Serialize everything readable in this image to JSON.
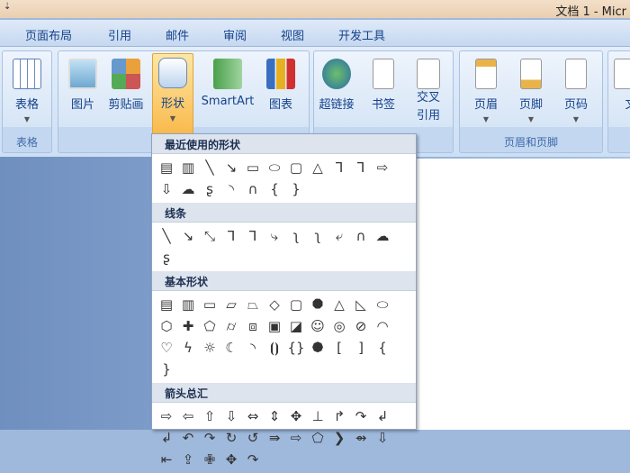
{
  "title_bar": {
    "title": "文档 1 - Micr",
    "qat": "⇣"
  },
  "tabs": [
    "页面布局",
    "引用",
    "邮件",
    "审阅",
    "视图",
    "开发工具"
  ],
  "ribbon": {
    "table_group": {
      "button": "表格",
      "label": "表格"
    },
    "illustrations": [
      "图片",
      "剪贴画",
      "形状",
      "SmartArt",
      "图表"
    ],
    "links": [
      "超链接",
      "书签",
      "交叉\n引用"
    ],
    "header_footer": {
      "buttons": [
        "页眉",
        "页脚",
        "页码"
      ],
      "label": "页眉和页脚"
    },
    "partial": "文"
  },
  "menu": {
    "sections": [
      {
        "title": "最近使用的形状",
        "shapes": [
          "▤",
          "▥",
          "╲",
          "↘",
          "▭",
          "⬭",
          "▢",
          "△",
          "⅂",
          "⅂",
          "⇨",
          "⇩",
          "☁",
          "ʂ",
          "◝",
          "∩",
          "{",
          "}"
        ]
      },
      {
        "title": "线条",
        "shapes": [
          "╲",
          "↘",
          "⤡",
          "⅂",
          "⅂",
          "⤷",
          "ʅ",
          "ʅ",
          "⤶",
          "∩",
          "☁",
          "ʂ"
        ]
      },
      {
        "title": "基本形状",
        "shapes": [
          "▤",
          "▥",
          "▭",
          "▱",
          "⏢",
          "◇",
          "▢",
          "⯃",
          "△",
          "◺",
          "⬭",
          "⬡",
          "✚",
          "⬠",
          "⌭",
          "⧈",
          "▣",
          "◪",
          "☺",
          "◎",
          "⊘",
          "◠",
          "♡",
          "ϟ",
          "☼",
          "☾",
          "◝",
          "⦗⦘",
          "{}",
          "⯄",
          "[",
          "]",
          "{",
          "}"
        ]
      },
      {
        "title": "箭头总汇",
        "shapes": [
          "⇨",
          "⇦",
          "⇧",
          "⇩",
          "⇔",
          "⇕",
          "✥",
          "⊥",
          "↱",
          "↷",
          "↲",
          "↲",
          "↶",
          "↷",
          "↻",
          "↺",
          "⇛",
          "⇨",
          "⬠",
          "❯",
          "⇴",
          "⇩",
          "⇤",
          "⇪",
          "✙",
          "✥",
          "↷"
        ]
      }
    ]
  }
}
